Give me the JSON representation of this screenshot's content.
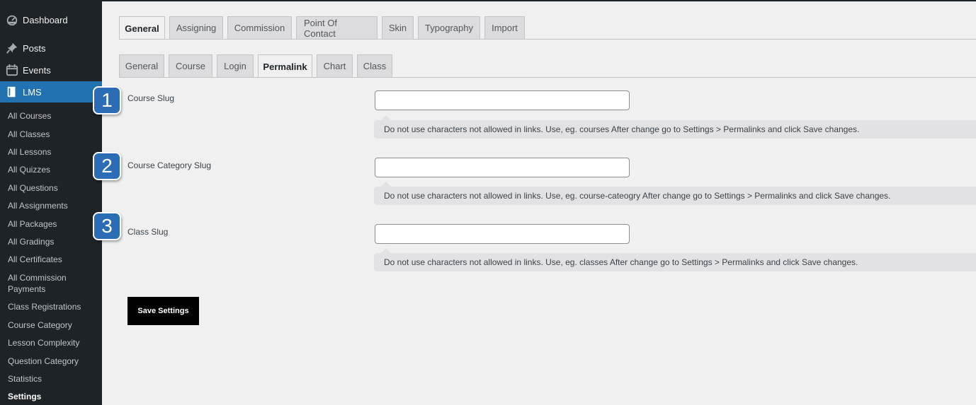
{
  "sidebar": {
    "dashboard": "Dashboard",
    "posts": "Posts",
    "events": "Events",
    "lms": "LMS",
    "sub_items": [
      "All Courses",
      "All Classes",
      "All Lessons",
      "All Quizzes",
      "All Questions",
      "All Assignments",
      "All Packages",
      "All Gradings",
      "All Certificates",
      "All Commission Payments",
      "Class Registrations",
      "Course Category",
      "Lesson Complexity",
      "Question Category",
      "Statistics",
      "Settings"
    ],
    "icons": [
      "dashboard-icon",
      "pin-icon",
      "calendar-icon",
      "book-icon"
    ]
  },
  "main_tabs": [
    "General",
    "Assigning",
    "Commission",
    "Point Of Contact",
    "Skin",
    "Typography",
    "Import"
  ],
  "sub_tabs": [
    "General",
    "Course",
    "Login",
    "Permalink",
    "Chart",
    "Class"
  ],
  "fields": [
    {
      "badge": "1",
      "label": "Course Slug",
      "value": "",
      "help": "Do not use characters not allowed in links. Use, eg. courses After change go to Settings > Permalinks and click Save changes."
    },
    {
      "badge": "2",
      "label": "Course Category Slug",
      "value": "",
      "help": "Do not use characters not allowed in links. Use, eg. course-cateogry After change go to Settings > Permalinks and click Save changes."
    },
    {
      "badge": "3",
      "label": "Class Slug",
      "value": "",
      "help": "Do not use characters not allowed in links. Use, eg. classes After change go to Settings > Permalinks and click Save changes."
    }
  ],
  "save_label": "Save Settings",
  "colors": {
    "sidebar_bg": "#1d2327",
    "active_menu": "#2271b1",
    "badge": "#2a6db5"
  }
}
